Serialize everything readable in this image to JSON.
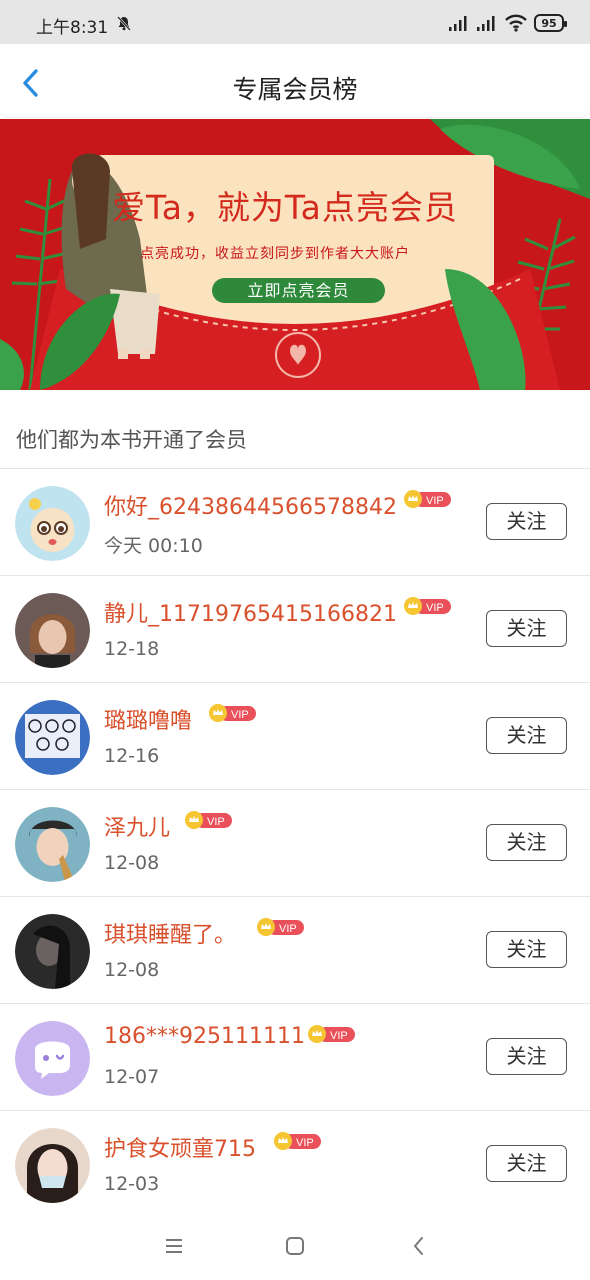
{
  "status_bar": {
    "time": "上午8:31",
    "battery": "95",
    "icons": [
      "bell-off-icon",
      "signal-icon",
      "signal-icon",
      "wifi-icon",
      "battery-icon"
    ]
  },
  "nav": {
    "title": "专属会员榜",
    "back_icon": "chevron-left-icon",
    "accent": "#2a8de0"
  },
  "banner": {
    "headline": "爱Ta，就为Ta点亮会员",
    "subtitle": "点亮成功，收益立刻同步到作者大大账户",
    "cta_label": "立即点亮会员",
    "bg_color": "#c8171b"
  },
  "section": {
    "title": "他们都为本书开通了会员"
  },
  "members": [
    {
      "name": "你好_62438644566578842",
      "date": "今天 00:10",
      "vip": "VIP",
      "follow": "关注",
      "avatar_color": "#bfe3ef"
    },
    {
      "name": "静儿_11719765415166821",
      "date": "12-18",
      "vip": "VIP",
      "follow": "关注",
      "avatar_color": "#6b5a55"
    },
    {
      "name": "璐璐噜噜",
      "date": "12-16",
      "vip": "VIP",
      "follow": "关注",
      "avatar_color": "#3a6fc2"
    },
    {
      "name": "泽九儿",
      "date": "12-08",
      "vip": "VIP",
      "follow": "关注",
      "avatar_color": "#7fb3c4"
    },
    {
      "name": "琪琪睡醒了。",
      "date": "12-08",
      "vip": "VIP",
      "follow": "关注",
      "avatar_color": "#2a2a2a"
    },
    {
      "name": "186***925111111",
      "date": "12-07",
      "vip": "VIP",
      "follow": "关注",
      "avatar_color": "#c9b6f0"
    },
    {
      "name": "护食女顽童715",
      "date": "12-03",
      "vip": "VIP",
      "follow": "关注",
      "avatar_color": "#e8d8cc"
    }
  ],
  "system_nav": [
    "menu-icon",
    "home-icon",
    "back-icon"
  ]
}
